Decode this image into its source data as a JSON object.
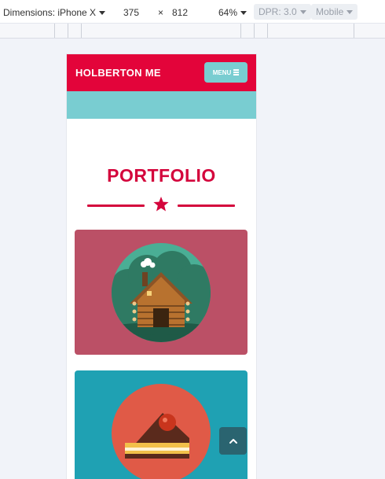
{
  "devtools": {
    "device_label": "Dimensions: iPhone X",
    "width": "375",
    "times": "×",
    "height": "812",
    "zoom": "64%",
    "dpr": "DPR: 3.0",
    "mode": "Mobile"
  },
  "site": {
    "brand": "HOLBERTON ME",
    "menu_label": "MENU"
  },
  "portfolio": {
    "title": "PORTFOLIO",
    "items": [
      {
        "icon": "log-cabin-icon"
      },
      {
        "icon": "cake-slice-icon"
      }
    ]
  },
  "icons": {
    "divider": "star-icon",
    "scroll_top": "chevron-up-icon",
    "menu": "hamburger-icon"
  },
  "colors": {
    "brand_red": "#e3043a",
    "accent_teal": "#79cdd1",
    "card_rose": "#bb5066",
    "card_teal": "#1fa1b3",
    "scroll_top_bg": "#2a6470"
  }
}
